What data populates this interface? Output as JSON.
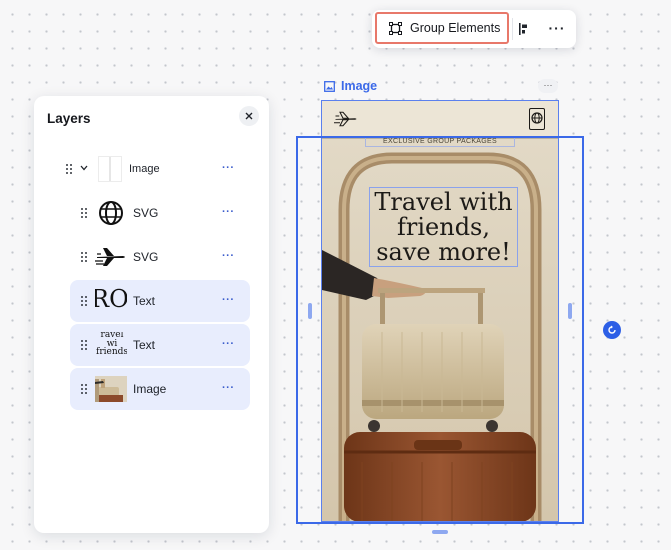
{
  "toolbar": {
    "group_label": "Group Elements",
    "more": "···"
  },
  "layers": {
    "title": "Layers",
    "items": [
      {
        "label": "Image",
        "more": "···",
        "depth": "parent",
        "selected": false,
        "thumb": "image"
      },
      {
        "label": "SVG",
        "more": "···",
        "depth": "child",
        "selected": false,
        "thumb": "globe"
      },
      {
        "label": "SVG",
        "more": "···",
        "depth": "child",
        "selected": false,
        "thumb": "plane"
      },
      {
        "label": "Text",
        "more": "···",
        "depth": "child",
        "selected": true,
        "thumb": "text-large",
        "thumb_text": "ROU"
      },
      {
        "label": "Text",
        "more": "···",
        "depth": "child",
        "selected": true,
        "thumb": "text-small",
        "thumb_text": "ravel wi friends save mor"
      },
      {
        "label": "Image",
        "more": "···",
        "depth": "child",
        "selected": true,
        "thumb": "suitcase-photo"
      }
    ]
  },
  "canvas": {
    "selection_label": "Image",
    "more": "···",
    "banner": "EXCLUSIVE GROUP PACKAGES",
    "headline_lines": [
      "Travel with",
      "friends,",
      "save more!"
    ],
    "colors": {
      "selection": "#3b69e8",
      "highlight": "#e8786a",
      "suitcase_top": "#d2c2a2",
      "suitcase_bottom": "#8c4a2b",
      "background": "#ddd3bf"
    }
  }
}
